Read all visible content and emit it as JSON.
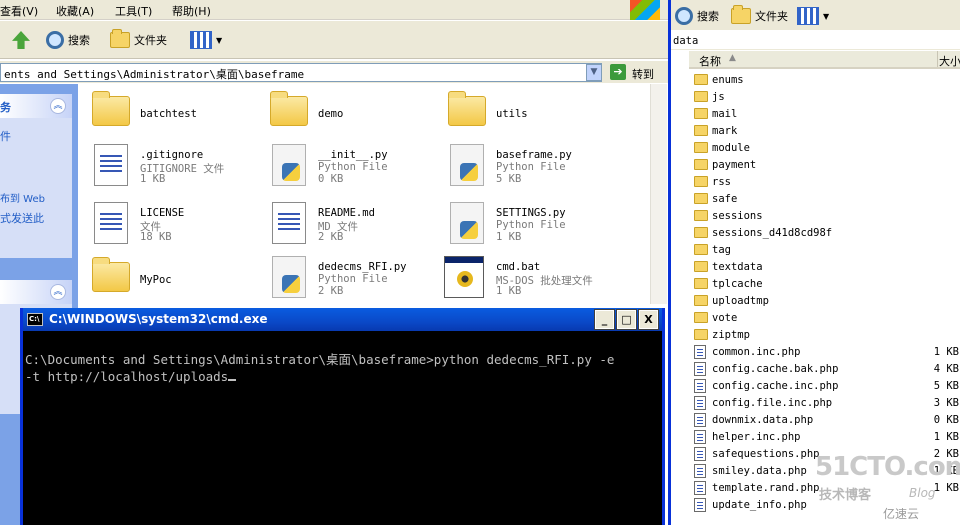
{
  "left_window": {
    "menu": {
      "view": "查看(V)",
      "favorites": "收藏(A)",
      "tools": "工具(T)",
      "help": "帮助(H)"
    },
    "toolbar": {
      "search_label": "搜索",
      "folders_label": "文件夹"
    },
    "address": {
      "path": "ents and Settings\\Administrator\\桌面\\baseframe",
      "go_label": "转到"
    },
    "taskpane": {
      "t1": "务",
      "t2": "件",
      "t3": "布到 Web",
      "t4": "式发送此"
    },
    "files": [
      {
        "name": "batchtest",
        "type": "folder"
      },
      {
        "name": "demo",
        "type": "folder"
      },
      {
        "name": "utils",
        "type": "folder"
      },
      {
        "name": ".gitignore",
        "desc": "GITIGNORE 文件",
        "size": "1 KB",
        "type": "doc"
      },
      {
        "name": "__init__.py",
        "desc": "Python File",
        "size": "0 KB",
        "type": "py"
      },
      {
        "name": "baseframe.py",
        "desc": "Python File",
        "size": "5 KB",
        "type": "py"
      },
      {
        "name": "LICENSE",
        "desc": "文件",
        "size": "18 KB",
        "type": "doc"
      },
      {
        "name": "README.md",
        "desc": "MD 文件",
        "size": "2 KB",
        "type": "doc"
      },
      {
        "name": "SETTINGS.py",
        "desc": "Python File",
        "size": "1 KB",
        "type": "py"
      },
      {
        "name": "MyPoc",
        "type": "folder"
      },
      {
        "name": "dedecms_RFI.py",
        "desc": "Python File",
        "size": "2 KB",
        "type": "py"
      },
      {
        "name": "cmd.bat",
        "desc": "MS-DOS 批处理文件",
        "size": "1 KB",
        "type": "bat"
      }
    ]
  },
  "cmd_window": {
    "title": "C:\\WINDOWS\\system32\\cmd.exe",
    "line1": "C:\\Documents and Settings\\Administrator\\桌面\\baseframe>python dedecms_RFI.py -e",
    "line2": "-t http://localhost/uploads",
    "min_glyph": "_",
    "max_glyph": "□",
    "close_glyph": "X"
  },
  "right_window": {
    "toolbar": {
      "search_label": "搜索",
      "folders_label": "文件夹"
    },
    "address": "data",
    "columns": {
      "name": "名称",
      "sort_glyph": "▲",
      "size": "大小"
    },
    "items": [
      {
        "name": "enums",
        "type": "folder",
        "size": ""
      },
      {
        "name": "js",
        "type": "folder",
        "size": ""
      },
      {
        "name": "mail",
        "type": "folder",
        "size": ""
      },
      {
        "name": "mark",
        "type": "folder",
        "size": ""
      },
      {
        "name": "module",
        "type": "folder",
        "size": ""
      },
      {
        "name": "payment",
        "type": "folder",
        "size": ""
      },
      {
        "name": "rss",
        "type": "folder",
        "size": ""
      },
      {
        "name": "safe",
        "type": "folder",
        "size": ""
      },
      {
        "name": "sessions",
        "type": "folder",
        "size": ""
      },
      {
        "name": "sessions_d41d8cd98f",
        "type": "folder",
        "size": ""
      },
      {
        "name": "tag",
        "type": "folder",
        "size": ""
      },
      {
        "name": "textdata",
        "type": "folder",
        "size": ""
      },
      {
        "name": "tplcache",
        "type": "folder",
        "size": ""
      },
      {
        "name": "uploadtmp",
        "type": "folder",
        "size": ""
      },
      {
        "name": "vote",
        "type": "folder",
        "size": ""
      },
      {
        "name": "ziptmp",
        "type": "folder",
        "size": ""
      },
      {
        "name": "common.inc.php",
        "type": "php",
        "size": "1 KB"
      },
      {
        "name": "config.cache.bak.php",
        "type": "php",
        "size": "4 KB"
      },
      {
        "name": "config.cache.inc.php",
        "type": "php",
        "size": "5 KB"
      },
      {
        "name": "config.file.inc.php",
        "type": "php",
        "size": "3 KB"
      },
      {
        "name": "downmix.data.php",
        "type": "php",
        "size": "0 KB"
      },
      {
        "name": "helper.inc.php",
        "type": "php",
        "size": "1 KB"
      },
      {
        "name": "safequestions.php",
        "type": "php",
        "size": "2 KB"
      },
      {
        "name": "smiley.data.php",
        "type": "php",
        "size": "1 KB"
      },
      {
        "name": "template.rand.php",
        "type": "php",
        "size": "1 KB"
      },
      {
        "name": "update_info.php",
        "type": "php",
        "size": ""
      }
    ]
  },
  "watermark": {
    "brand": "51CTO.com",
    "sub": "技术博客",
    "blog": "Blog",
    "yun": "亿速云"
  }
}
